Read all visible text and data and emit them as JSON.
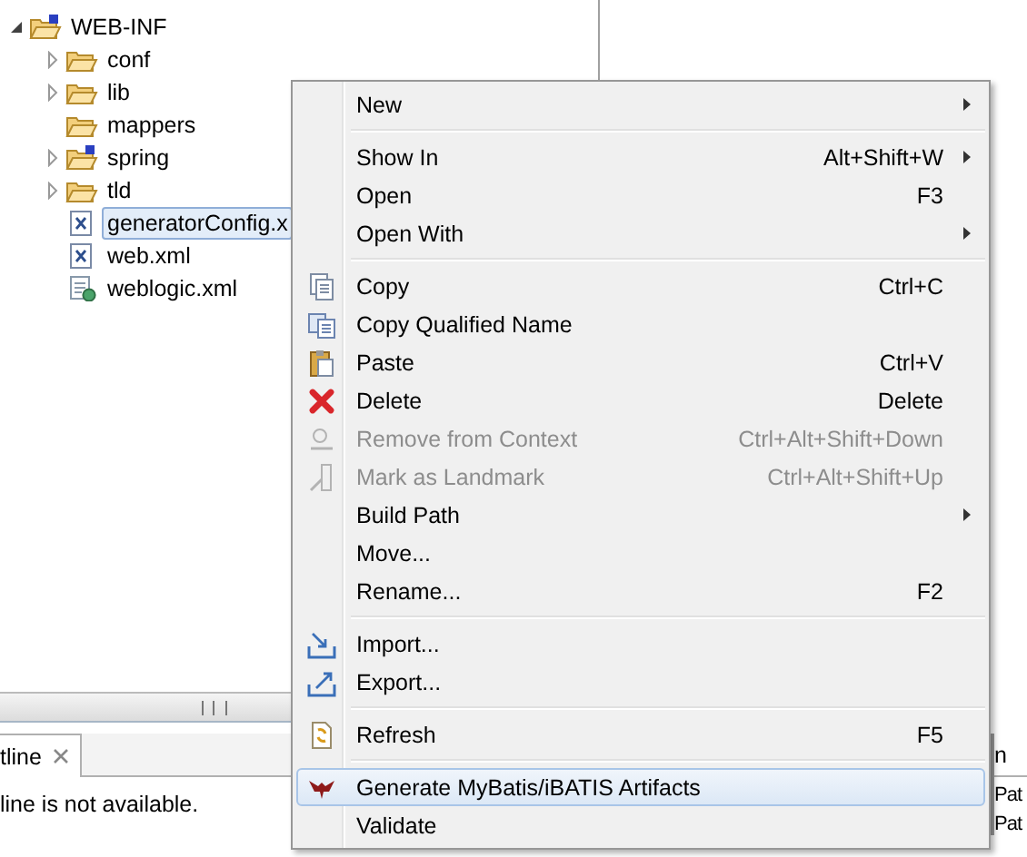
{
  "tree": [
    {
      "label": "WEB-INF",
      "kind": "spring-folder",
      "expanded": true,
      "selected": false,
      "children": [
        {
          "label": "conf",
          "kind": "folder",
          "expanded": false,
          "selected": false
        },
        {
          "label": "lib",
          "kind": "folder",
          "expanded": false,
          "selected": false
        },
        {
          "label": "mappers",
          "kind": "folder",
          "selected": false
        },
        {
          "label": "spring",
          "kind": "spring-folder",
          "expanded": false,
          "selected": false
        },
        {
          "label": "tld",
          "kind": "folder",
          "expanded": false,
          "selected": false
        },
        {
          "label": "generatorConfig.x",
          "kind": "xml-file",
          "selected": true
        },
        {
          "label": "web.xml",
          "kind": "xml-file",
          "selected": false
        },
        {
          "label": "weblogic.xml",
          "kind": "config-file",
          "selected": false
        }
      ]
    }
  ],
  "outline": {
    "tab": "tline",
    "message": "line is not available."
  },
  "side_panel": {
    "tab": "n",
    "rows": [
      "Pat",
      "Pat"
    ]
  },
  "menu": {
    "groups": [
      [
        {
          "label": "New",
          "submenu": true,
          "disabled": false,
          "selected": false
        }
      ],
      [
        {
          "label": "Show In",
          "shortcut": "Alt+Shift+W",
          "submenu": true,
          "disabled": false,
          "selected": false
        },
        {
          "label": "Open",
          "shortcut": "F3",
          "submenu": false,
          "disabled": false,
          "selected": false
        },
        {
          "label": "Open With",
          "submenu": true,
          "disabled": false,
          "selected": false
        }
      ],
      [
        {
          "label": "Copy",
          "shortcut": "Ctrl+C",
          "submenu": false,
          "disabled": false,
          "selected": false
        },
        {
          "label": "Copy Qualified Name",
          "submenu": false,
          "disabled": false,
          "selected": false
        },
        {
          "label": "Paste",
          "shortcut": "Ctrl+V",
          "submenu": false,
          "disabled": false,
          "selected": false
        },
        {
          "label": "Delete",
          "shortcut": "Delete",
          "submenu": false,
          "disabled": false,
          "selected": false
        },
        {
          "label": "Remove from Context",
          "shortcut": "Ctrl+Alt+Shift+Down",
          "submenu": false,
          "disabled": true,
          "selected": false
        },
        {
          "label": "Mark as Landmark",
          "shortcut": "Ctrl+Alt+Shift+Up",
          "submenu": false,
          "disabled": true,
          "selected": false
        },
        {
          "label": "Build Path",
          "submenu": true,
          "disabled": false,
          "selected": false
        },
        {
          "label": "Move...",
          "submenu": false,
          "disabled": false,
          "selected": false
        },
        {
          "label": "Rename...",
          "shortcut": "F2",
          "submenu": false,
          "disabled": false,
          "selected": false
        }
      ],
      [
        {
          "label": "Import...",
          "submenu": false,
          "disabled": false,
          "selected": false
        },
        {
          "label": "Export...",
          "submenu": false,
          "disabled": false,
          "selected": false
        }
      ],
      [
        {
          "label": "Refresh",
          "shortcut": "F5",
          "submenu": false,
          "disabled": false,
          "selected": false
        }
      ],
      [
        {
          "label": "Generate MyBatis/iBATIS Artifacts",
          "submenu": false,
          "disabled": false,
          "selected": true
        },
        {
          "label": "Validate",
          "submenu": false,
          "disabled": false,
          "selected": false
        }
      ]
    ]
  }
}
